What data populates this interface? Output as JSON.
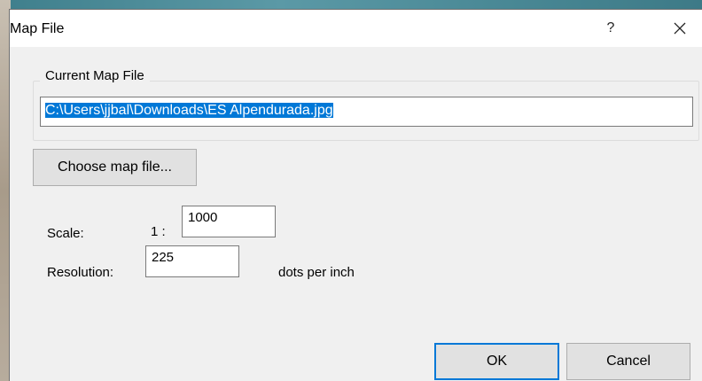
{
  "window": {
    "title": "Map File",
    "help_label": "?"
  },
  "current_map": {
    "group_label": "Current Map File",
    "path": "C:\\Users\\jjbal\\Downloads\\ES Alpendurada.jpg"
  },
  "choose_button": "Choose map file...",
  "scale": {
    "label": "Scale:",
    "prefix": "1 :",
    "value": "1000"
  },
  "resolution": {
    "label": "Resolution:",
    "value": "225",
    "unit": "dots per inch"
  },
  "buttons": {
    "ok": "OK",
    "cancel": "Cancel"
  }
}
